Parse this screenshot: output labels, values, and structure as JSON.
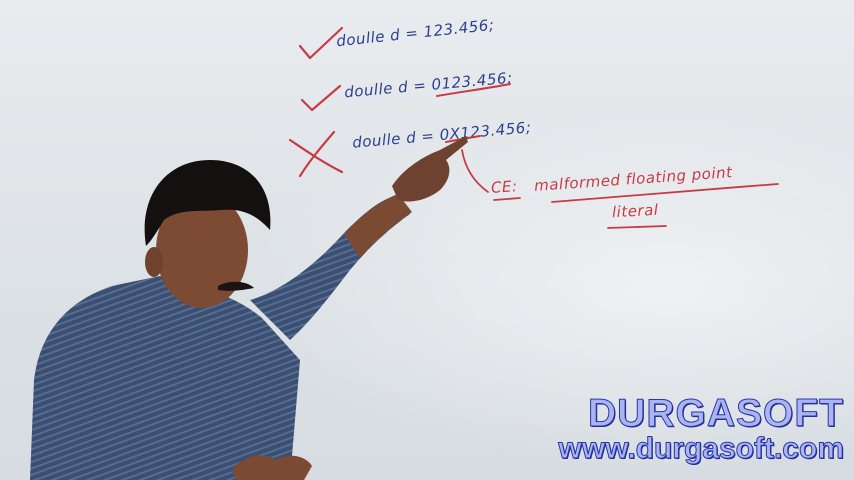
{
  "board": {
    "line1": "doulle d = 123.456;",
    "line2": "doulle d = 0123.456;",
    "line3": "doulle d = 0X123.456;",
    "error_prefix": "CE:",
    "error_line1": "malformed floating point",
    "error_line2": "literal"
  },
  "watermark": {
    "name": "DURGASOFT",
    "url": "www.durgasoft.com"
  },
  "colors": {
    "marker_blue": "#2c3f8f",
    "marker_red": "#c83a44",
    "watermark_fill": "#a9b4f0",
    "watermark_outline": "#2a36a8"
  }
}
